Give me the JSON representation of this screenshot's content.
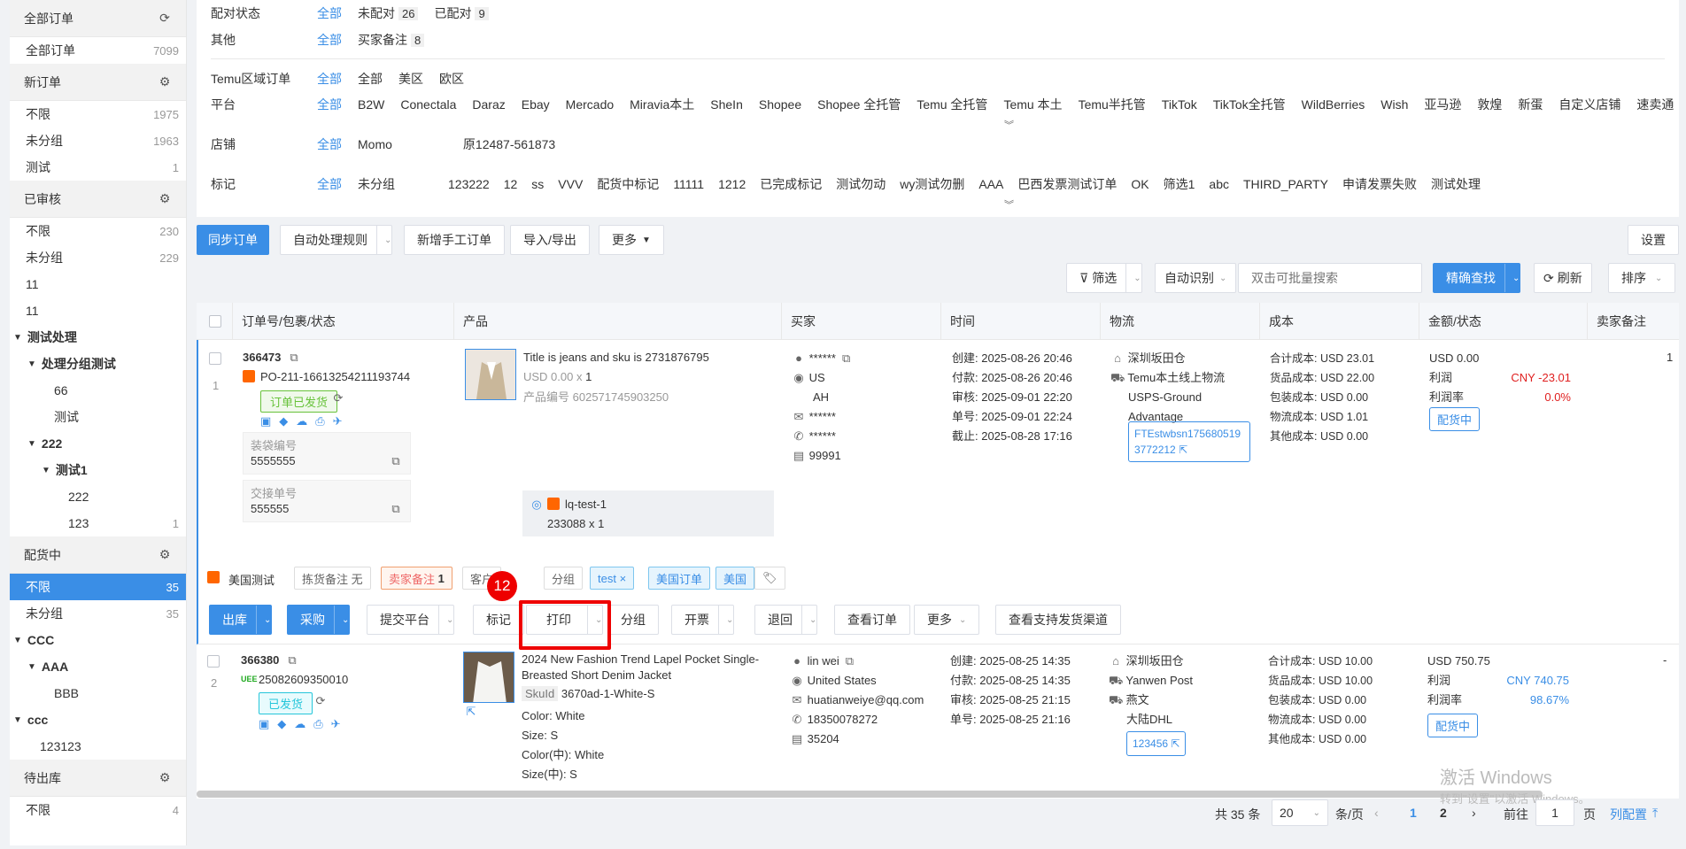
{
  "sidebar": {
    "all_orders": {
      "title": "全部订单",
      "items": [
        {
          "label": "全部订单",
          "count": "7099"
        }
      ]
    },
    "new_orders": {
      "title": "新订单",
      "items": [
        {
          "label": "不限",
          "count": "1975"
        },
        {
          "label": "未分组",
          "count": "1963"
        },
        {
          "label": "测试",
          "count": "1"
        }
      ]
    },
    "reviewed": {
      "title": "已审核",
      "items": [
        {
          "label": "不限",
          "count": "230"
        },
        {
          "label": "未分组",
          "count": "229"
        },
        {
          "label": "11",
          "count": ""
        },
        {
          "label": "11",
          "count": ""
        }
      ]
    },
    "tree1": {
      "root": "测试处理",
      "child": "处理分组测试",
      "leaves": [
        "66",
        "测试"
      ],
      "n222": "222",
      "n_test1": "测试1",
      "leaf222": "222",
      "leaf123": "123",
      "leaf123_count": "1"
    },
    "allocating": {
      "title": "配货中",
      "items": [
        {
          "label": "不限",
          "count": "35"
        },
        {
          "label": "未分组",
          "count": "35"
        }
      ]
    },
    "tree2": {
      "ccc": "CCC",
      "aaa": "AAA",
      "bbb": "BBB",
      "ccc2": "ccc",
      "n123123": "123123"
    },
    "pending_out": {
      "title": "待出库",
      "items": [
        {
          "label": "不限",
          "count": "4"
        }
      ]
    }
  },
  "filters": {
    "match": {
      "label": "配对状态",
      "all": "全部",
      "opts": [
        {
          "t": "未配对",
          "n": "26"
        },
        {
          "t": "已配对",
          "n": "9"
        }
      ]
    },
    "other": {
      "label": "其他",
      "all": "全部",
      "opts": [
        {
          "t": "买家备注",
          "n": "8"
        }
      ]
    },
    "region": {
      "label": "Temu区域订单",
      "all": "全部",
      "opts": [
        "全部",
        "美区",
        "欧区"
      ]
    },
    "platform": {
      "label": "平台",
      "all": "全部",
      "opts": [
        "B2W",
        "Conectala",
        "Daraz",
        "Ebay",
        "Mercado",
        "Miravia本土",
        "SheIn",
        "Shopee",
        "Shopee 全托管",
        "Temu 全托管",
        "Temu 本土",
        "Temu半托管",
        "TikTok",
        "TikTok全托管",
        "WildBerries",
        "Wish",
        "亚马逊",
        "敦煌",
        "新蛋",
        "自定义店铺",
        "速卖通"
      ]
    },
    "shop": {
      "label": "店铺",
      "all": "全部",
      "opts": [
        "Momo",
        "原12487-561873"
      ]
    },
    "mark": {
      "label": "标记",
      "all": "全部",
      "opts": [
        "未分组",
        "123222",
        "12",
        "ss",
        "VVV",
        "配货中标记",
        "11111",
        "1212",
        "已完成标记",
        "测试勿动",
        "wy测试勿删",
        "AAA",
        "巴西发票测试订单",
        "OK",
        "筛选1",
        "abc",
        "THIRD_PARTY",
        "申请发票失败",
        "测试处理"
      ]
    }
  },
  "toolbar": {
    "sync": "同步订单",
    "auto_rule": "自动处理规则",
    "new_manual": "新增手工订单",
    "import_export": "导入/导出",
    "more": "更多",
    "settings": "设置"
  },
  "search": {
    "filter": "筛选",
    "auto_detect": "自动识别",
    "placeholder": "双击可批量搜索",
    "exact": "精确查找",
    "refresh": "刷新",
    "sort": "排序"
  },
  "columns": [
    "订单号/包裹/状态",
    "产品",
    "买家",
    "时间",
    "物流",
    "成本",
    "金额/状态",
    "卖家备注"
  ],
  "order1": {
    "idx": "1",
    "order_no": "366473",
    "package": "PO-211-16613254211193744",
    "status": "订单已发货",
    "bag_label": "装袋编号",
    "bag_no": "5555555",
    "handover_label": "交接单号",
    "handover_no": "555555",
    "product_title": "Title is jeans and sku is 2731876795",
    "price": "USD 0.00",
    "qty": "1",
    "product_code_label": "产品编号",
    "product_code": "602571745903250",
    "sub_name": "lq-test-1",
    "sub_qty": "233088 x 1",
    "buyer": {
      "name": "******",
      "country": "US",
      "state": "AH",
      "email": "******",
      "phone": "******",
      "zip": "99991"
    },
    "times": [
      "创建: 2025-08-26 20:46",
      "付款: 2025-08-26 20:46",
      "审核: 2025-09-01 22:20",
      "单号: 2025-09-01 22:24",
      "截止: 2025-08-28 17:16"
    ],
    "logistics": {
      "warehouse": "深圳坂田仓",
      "carrier": "Temu本土线上物流",
      "service": "USPS-Ground Advantage",
      "tracking": "FTEstwbsn1756805193772212"
    },
    "cost": [
      "合计成本:  USD 23.01",
      "货品成本:  USD 22.00",
      "包装成本:  USD 0.00",
      "物流成本:  USD 1.01",
      "其他成本:  USD 0.00"
    ],
    "amount": "USD 0.00",
    "profit_label": "利润",
    "profit": "CNY -23.01",
    "margin_label": "利润率",
    "margin": "0.0%",
    "state": "配货中",
    "seller_note": "1"
  },
  "tagbar": {
    "shop": "美国测试",
    "pick_note": "拣货备注 无",
    "seller_note": "卖家备注",
    "seller_note_n": "1",
    "customer": "客户",
    "group": "分组",
    "tag1": "test",
    "tag2": "美国订单",
    "tag3": "美国"
  },
  "actions": {
    "outbound": "出库",
    "purchase": "采购",
    "submit": "提交平台",
    "mark": "标记",
    "print": "打印",
    "group": "分组",
    "invoice": "开票",
    "return": "退回",
    "view": "查看订单",
    "more": "更多",
    "channels": "查看支持发货渠道"
  },
  "marker": {
    "number": "12"
  },
  "order2": {
    "idx": "2",
    "order_no": "366380",
    "package": "25082609350010",
    "status": "已发货",
    "product_title": "2024 New Fashion Trend Lapel Pocket Single-Breasted Short Denim Jacket",
    "skuid_label": "SkuId",
    "skuid": "3670ad-1-White-S",
    "attrs": [
      "Color: White",
      "Size: S",
      "Color(中): White",
      "Size(中): S"
    ],
    "buyer": {
      "name": "lin wei",
      "country": "United States",
      "email": "huatianweiye@qq.com",
      "phone": "18350078272",
      "zip": "35204"
    },
    "times": [
      "创建: 2025-08-25 14:35",
      "付款: 2025-08-25 14:35",
      "审核: 2025-08-25 21:15",
      "单号: 2025-08-25 21:16"
    ],
    "logistics": {
      "warehouse": "深圳坂田仓",
      "carrier": "Yanwen Post",
      "service": "燕文",
      "service2": "大陆DHL",
      "tracking": "123456"
    },
    "cost": [
      "合计成本:  USD 10.00",
      "货品成本:  USD 10.00",
      "包装成本:  USD 0.00",
      "物流成本:  USD 0.00",
      "其他成本:  USD 0.00"
    ],
    "amount": "USD 750.75",
    "profit_label": "利润",
    "profit": "CNY 740.75",
    "margin_label": "利润率",
    "margin": "98.67%",
    "state": "配货中",
    "seller_note": "-"
  },
  "pager": {
    "total": "共 35 条",
    "size": "20",
    "per": "条/页",
    "p1": "1",
    "p2": "2",
    "goto": "前往",
    "page_val": "1",
    "page": "页",
    "col_cfg": "列配置"
  },
  "watermark": {
    "line1": "激活 Windows",
    "line2": "转到\"设置\"以激活 Windows。"
  }
}
